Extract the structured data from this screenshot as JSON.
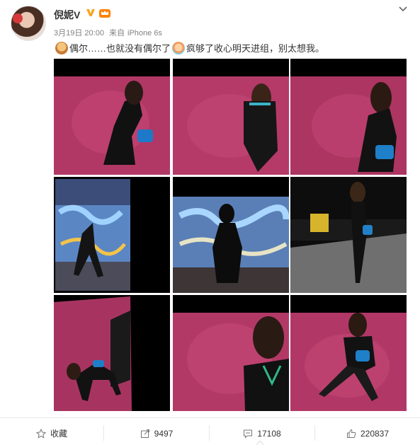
{
  "post": {
    "username": "倪妮V",
    "date": "3月19日 20:00",
    "source_prefix": "来自",
    "source": "iPhone 6s",
    "text_part1": "偶尔……也就没有偶尔了",
    "text_part2": "疯够了收心明天进组，别太想我。"
  },
  "icons": {
    "avatar": "avatar-image",
    "verified": "verified-v-icon",
    "crown": "member-crown-icon",
    "more": "chevron-down-icon",
    "emoji1": "emoji-icon",
    "emoji2": "emoji-icon"
  },
  "colors": {
    "verified": "#f5a623",
    "crown": "#ff8200",
    "magenta_wall": "#b13865",
    "text": "#333333",
    "meta": "#808080"
  },
  "actions": {
    "favorite_label": "收藏",
    "repost_count": "9497",
    "comment_count": "17108",
    "like_count": "220837"
  }
}
